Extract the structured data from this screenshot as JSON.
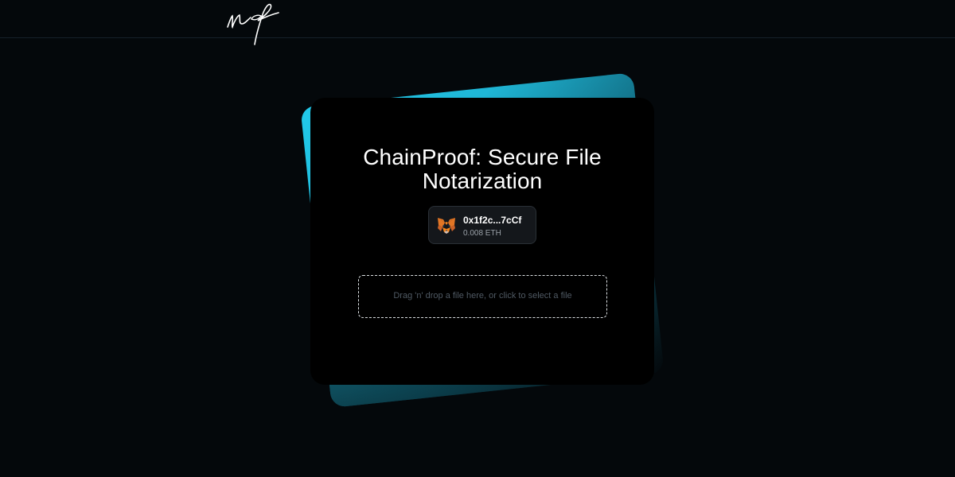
{
  "header": {
    "logo_icon": "signature-logo-icon"
  },
  "card": {
    "title": "ChainProof: Secure File Notarization"
  },
  "wallet": {
    "icon": "metamask-fox-icon",
    "address": "0x1f2c...7cCf",
    "balance": "0.008 ETH"
  },
  "dropzone": {
    "label": "Drag 'n' drop a file here, or click to select a file"
  },
  "colors": {
    "background": "#04080b",
    "card": "#000000",
    "accent": "#21c9ea"
  }
}
